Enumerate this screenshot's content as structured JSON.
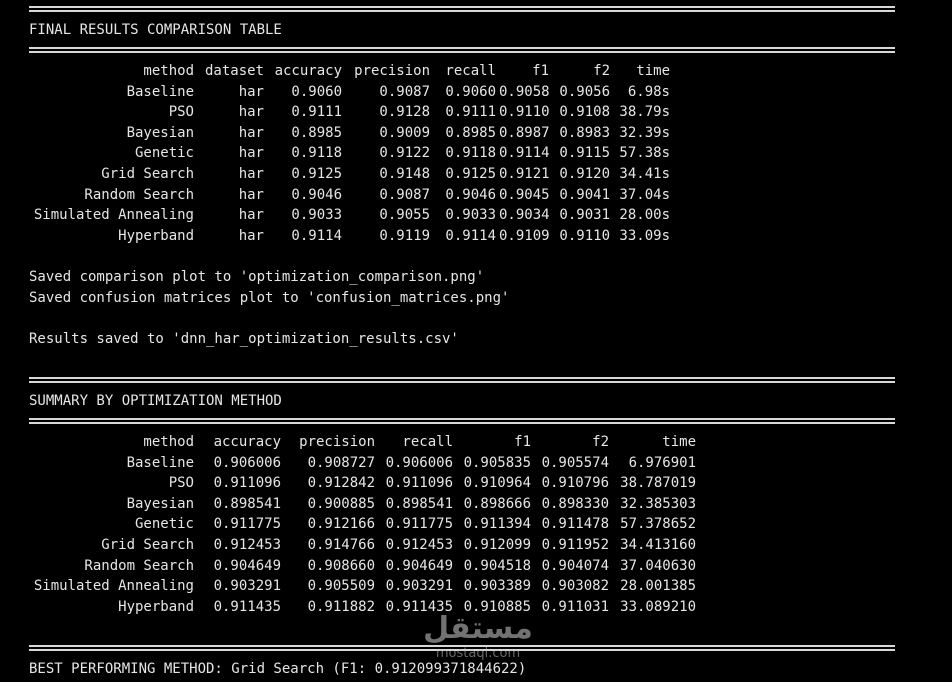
{
  "console": {
    "final_title": "FINAL RESULTS COMPARISON TABLE",
    "results_table": {
      "headers": [
        "method",
        "dataset",
        "accuracy",
        "precision",
        "recall",
        "f1",
        "f2",
        "time"
      ],
      "rows": [
        [
          "Baseline",
          "har",
          "0.9060",
          "0.9087",
          "0.9060",
          "0.9058",
          "0.9056",
          "6.98s"
        ],
        [
          "PSO",
          "har",
          "0.9111",
          "0.9128",
          "0.9111",
          "0.9110",
          "0.9108",
          "38.79s"
        ],
        [
          "Bayesian",
          "har",
          "0.8985",
          "0.9009",
          "0.8985",
          "0.8987",
          "0.8983",
          "32.39s"
        ],
        [
          "Genetic",
          "har",
          "0.9118",
          "0.9122",
          "0.9118",
          "0.9114",
          "0.9115",
          "57.38s"
        ],
        [
          "Grid Search",
          "har",
          "0.9125",
          "0.9148",
          "0.9125",
          "0.9121",
          "0.9120",
          "34.41s"
        ],
        [
          "Random Search",
          "har",
          "0.9046",
          "0.9087",
          "0.9046",
          "0.9045",
          "0.9041",
          "37.04s"
        ],
        [
          "Simulated Annealing",
          "har",
          "0.9033",
          "0.9055",
          "0.9033",
          "0.9034",
          "0.9031",
          "28.00s"
        ],
        [
          "Hyperband",
          "har",
          "0.9114",
          "0.9119",
          "0.9114",
          "0.9109",
          "0.9110",
          "33.09s"
        ]
      ]
    },
    "saved_comparison": "Saved comparison plot to 'optimization_comparison.png'",
    "saved_confusion": "Saved confusion matrices plot to 'confusion_matrices.png'",
    "results_saved": "Results saved to 'dnn_har_optimization_results.csv'",
    "summary_title": "SUMMARY BY OPTIMIZATION METHOD",
    "summary_table": {
      "headers": [
        "method",
        "accuracy",
        "precision",
        "recall",
        "f1",
        "f2",
        "time"
      ],
      "rows": [
        [
          "Baseline",
          "0.906006",
          "0.908727",
          "0.906006",
          "0.905835",
          "0.905574",
          "6.976901"
        ],
        [
          "PSO",
          "0.911096",
          "0.912842",
          "0.911096",
          "0.910964",
          "0.910796",
          "38.787019"
        ],
        [
          "Bayesian",
          "0.898541",
          "0.900885",
          "0.898541",
          "0.898666",
          "0.898330",
          "32.385303"
        ],
        [
          "Genetic",
          "0.911775",
          "0.912166",
          "0.911775",
          "0.911394",
          "0.911478",
          "57.378652"
        ],
        [
          "Grid Search",
          "0.912453",
          "0.914766",
          "0.912453",
          "0.912099",
          "0.911952",
          "34.413160"
        ],
        [
          "Random Search",
          "0.904649",
          "0.908660",
          "0.904649",
          "0.904518",
          "0.904074",
          "37.040630"
        ],
        [
          "Simulated Annealing",
          "0.903291",
          "0.905509",
          "0.903291",
          "0.903389",
          "0.903082",
          "28.001385"
        ],
        [
          "Hyperband",
          "0.911435",
          "0.911882",
          "0.911435",
          "0.910885",
          "0.911031",
          "33.089210"
        ]
      ]
    },
    "best_method": "BEST PERFORMING METHOD: Grid Search (F1: 0.912099371844622)"
  },
  "watermark": {
    "text": "مستقل",
    "sub": "mostaql.com"
  }
}
